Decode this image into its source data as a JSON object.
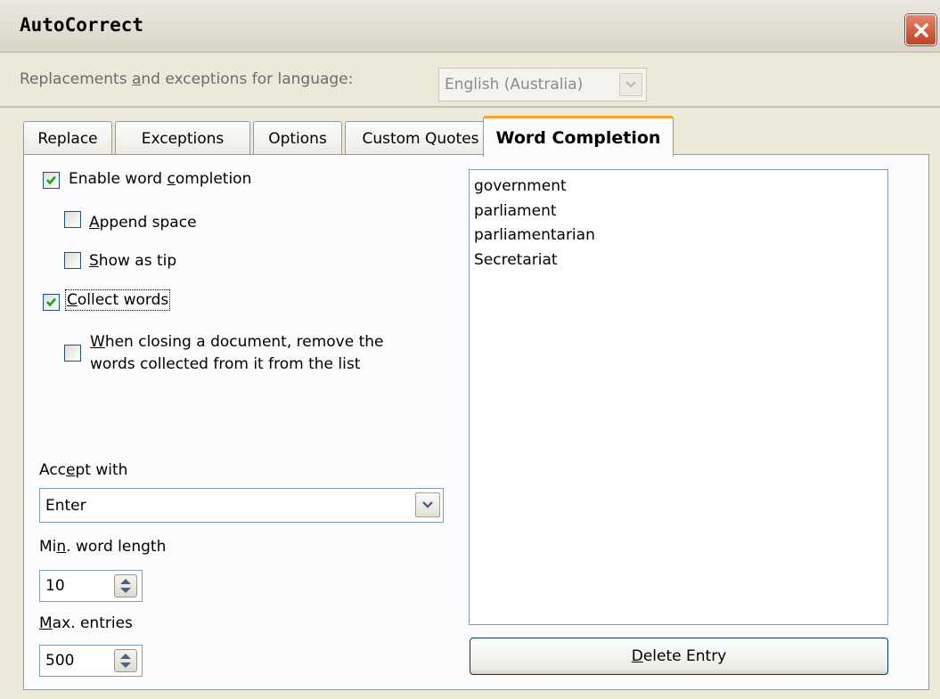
{
  "window": {
    "title": "AutoCorrect",
    "close_icon": "close-icon"
  },
  "language": {
    "label_pre": "Replacements ",
    "label_u": "a",
    "label_post": "nd exceptions for language:",
    "value": "English (Australia)"
  },
  "tabs": [
    {
      "label": "Replace"
    },
    {
      "label": "Exceptions"
    },
    {
      "label": "Options"
    },
    {
      "label": "Custom Quotes"
    },
    {
      "label": "Word Completion",
      "active": true
    }
  ],
  "options": {
    "enable": {
      "pre": "Enable word ",
      "u": "c",
      "post": "ompletion",
      "checked": true
    },
    "append": {
      "pre": "",
      "u": "A",
      "post": "ppend space",
      "checked": false
    },
    "show_tip": {
      "pre": "",
      "u": "S",
      "post": "how as tip",
      "checked": false
    },
    "collect": {
      "pre": "",
      "u": "C",
      "post": "ollect words",
      "checked": true
    },
    "remove_line1": {
      "pre": "",
      "u": "W",
      "post": "hen closing a document, remove the"
    },
    "remove_line2": "words collected from it from the list",
    "remove_checked": false
  },
  "accept": {
    "label_pre": "Acc",
    "label_u": "e",
    "label_post": "pt with",
    "value": "Enter"
  },
  "min_length": {
    "label_pre": "Mi",
    "label_u": "n",
    "label_post": ". word length",
    "value": "10"
  },
  "max_entries": {
    "label_pre": "",
    "label_u": "M",
    "label_post": "ax. entries",
    "value": "500"
  },
  "words": [
    "government",
    "parliament",
    "parliamentarian",
    "Secretariat"
  ],
  "delete_button": {
    "pre": "",
    "u": "D",
    "post": "elete Entry"
  },
  "colors": {
    "tab_accent": "#f6a327",
    "check": "#21a121",
    "close": "#c2411f"
  }
}
